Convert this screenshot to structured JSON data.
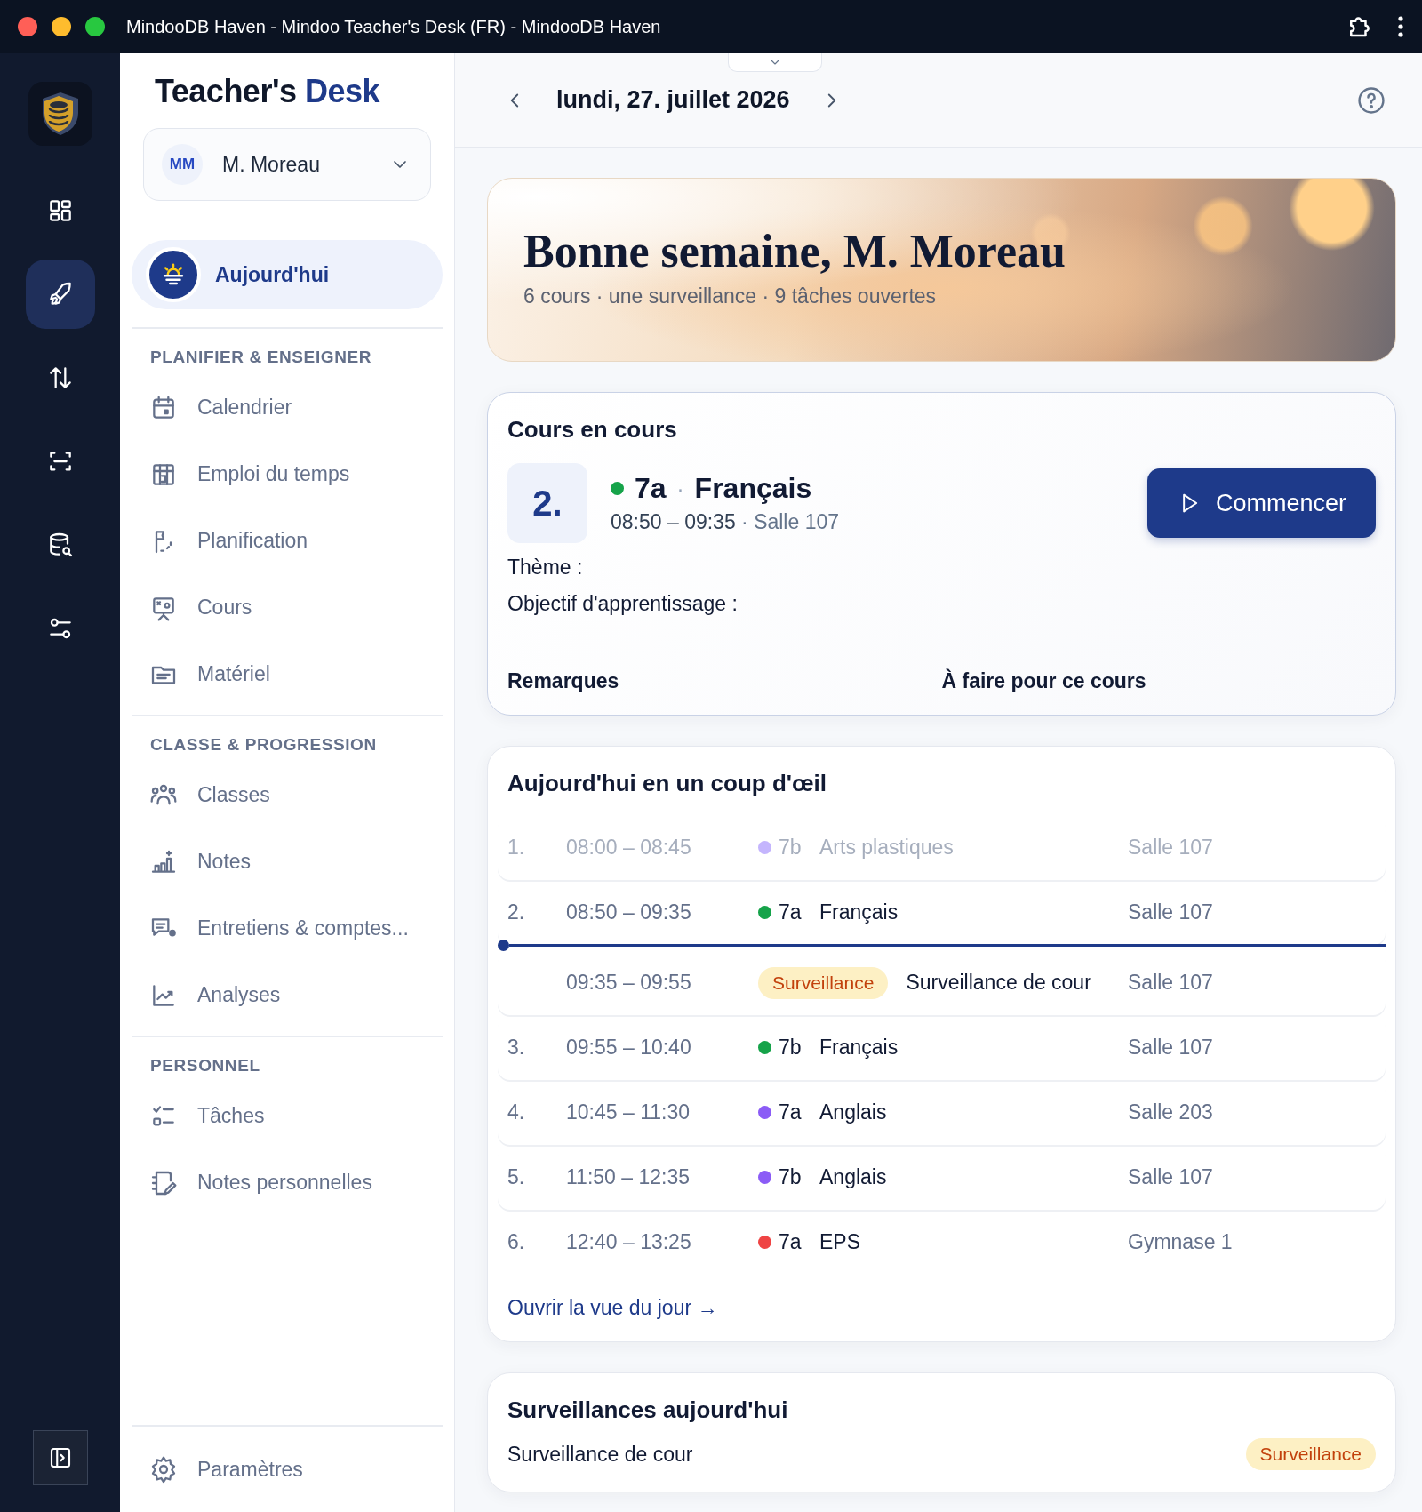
{
  "window": {
    "title": "MindooDB Haven - Mindoo Teacher's Desk (FR) - MindooDB Haven"
  },
  "rail": {
    "items": [
      {
        "selected": false
      },
      {
        "selected": true
      },
      {
        "selected": false
      },
      {
        "selected": false
      },
      {
        "selected": false
      },
      {
        "selected": false
      }
    ]
  },
  "sidebar": {
    "brand": {
      "first": "Teacher's",
      "second": "Desk"
    },
    "user": {
      "initials": "MM",
      "name": "M. Moreau"
    },
    "today": {
      "label": "Aujourd'hui",
      "selected": true
    },
    "sections": [
      {
        "title": "PLANIFIER & ENSEIGNER",
        "items": [
          {
            "label": "Calendrier",
            "selected": false
          },
          {
            "label": "Emploi du temps",
            "selected": false
          },
          {
            "label": "Planification",
            "selected": false
          },
          {
            "label": "Cours",
            "selected": false
          },
          {
            "label": "Matériel",
            "selected": false
          }
        ]
      },
      {
        "title": "CLASSE & PROGRESSION",
        "items": [
          {
            "label": "Classes",
            "selected": false
          },
          {
            "label": "Notes",
            "selected": false
          },
          {
            "label": "Entretiens & comptes...",
            "selected": false
          },
          {
            "label": "Analyses",
            "selected": false
          }
        ]
      },
      {
        "title": "PERSONNEL",
        "items": [
          {
            "label": "Tâches",
            "selected": false
          },
          {
            "label": "Notes personnelles",
            "selected": false
          }
        ]
      }
    ],
    "settings": {
      "label": "Paramètres"
    }
  },
  "header": {
    "date": "lundi, 27. juillet 2026"
  },
  "hero": {
    "title": "Bonne semaine, M. Moreau",
    "subtitle": "6 cours · une surveillance · 9 tâches ouvertes"
  },
  "current_lesson": {
    "title": "Cours en cours",
    "number": "2.",
    "color": "#16a34a",
    "class": "7a",
    "separator": "·",
    "subject": "Français",
    "time": "08:50 – 09:35",
    "room_separator": "·",
    "room": "Salle 107",
    "button": "Commencer",
    "fields": [
      "Thème :",
      "Objectif d'apprentissage :"
    ],
    "columns": [
      "Remarques",
      "À faire pour ce cours"
    ]
  },
  "glance": {
    "title": "Aujourd'hui en un coup d'œil",
    "rows": [
      {
        "kind": "lesson",
        "past": true,
        "number": "1.",
        "time": "08:00 – 08:45",
        "color": "#c4b5fd",
        "class": "7b",
        "subject": "Arts plastiques",
        "room": "Salle 107"
      },
      {
        "kind": "lesson",
        "past": false,
        "number": "2.",
        "time": "08:50 – 09:35",
        "color": "#16a34a",
        "class": "7a",
        "subject": "Français",
        "room": "Salle 107"
      },
      {
        "kind": "now"
      },
      {
        "kind": "duty",
        "past": false,
        "time": "09:35 – 09:55",
        "badge": "Surveillance",
        "subject": "Surveillance de cour",
        "room": "Salle 107"
      },
      {
        "kind": "lesson",
        "past": false,
        "number": "3.",
        "time": "09:55 – 10:40",
        "color": "#16a34a",
        "class": "7b",
        "subject": "Français",
        "room": "Salle 107"
      },
      {
        "kind": "lesson",
        "past": false,
        "number": "4.",
        "time": "10:45 – 11:30",
        "color": "#8b5cf6",
        "class": "7a",
        "subject": "Anglais",
        "room": "Salle 203"
      },
      {
        "kind": "lesson",
        "past": false,
        "number": "5.",
        "time": "11:50 – 12:35",
        "color": "#8b5cf6",
        "class": "7b",
        "subject": "Anglais",
        "room": "Salle 107"
      },
      {
        "kind": "lesson",
        "past": false,
        "number": "6.",
        "time": "12:40 – 13:25",
        "color": "#ef4444",
        "class": "7a",
        "subject": "EPS",
        "room": "Gymnase 1"
      }
    ],
    "link": "Ouvrir la vue du jour →"
  },
  "duties": {
    "title": "Surveillances aujourd'hui",
    "items": [
      {
        "label": "Surveillance de cour",
        "badge": "Surveillance"
      }
    ]
  }
}
